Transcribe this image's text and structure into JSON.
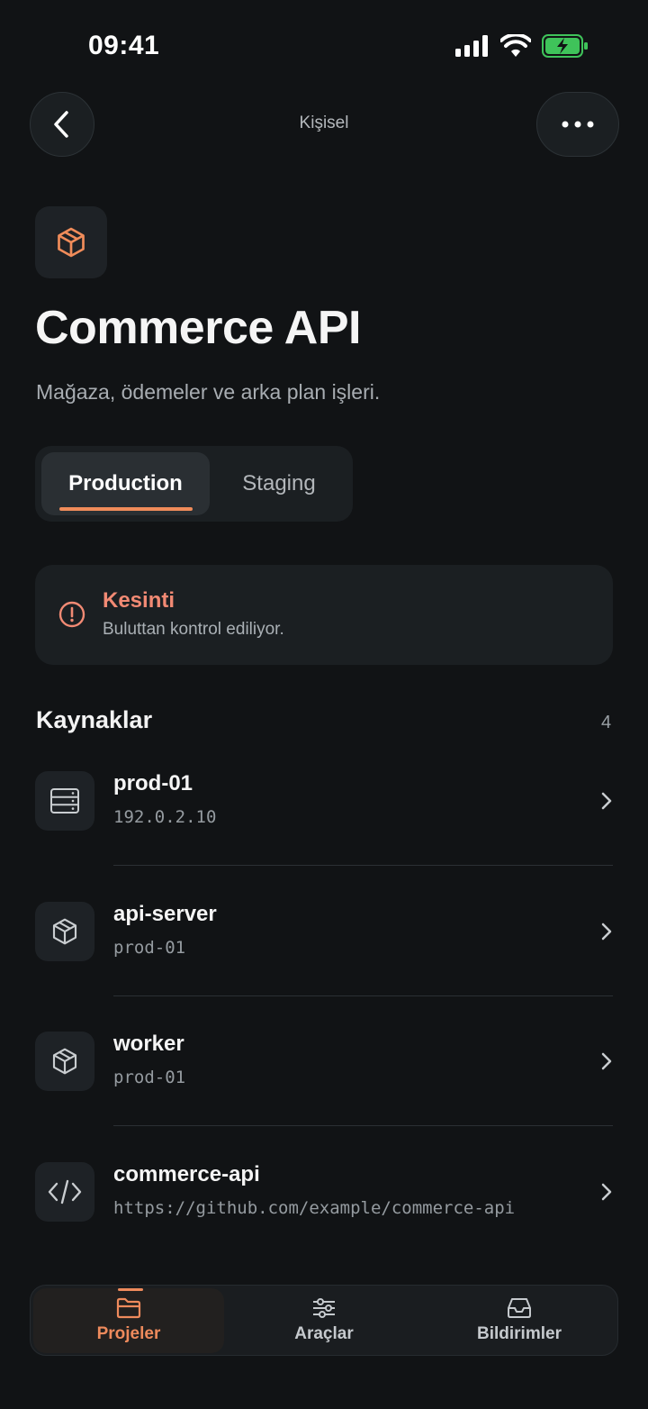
{
  "status_bar": {
    "time": "09:41"
  },
  "nav": {
    "title": "Kişisel"
  },
  "project": {
    "title": "Commerce API",
    "description": "Mağaza, ödemeler ve arka plan işleri."
  },
  "environments": {
    "production": "Production",
    "staging": "Staging",
    "selected": "Production"
  },
  "alert": {
    "title": "Kesinti",
    "subtitle": "Buluttan kontrol ediliyor."
  },
  "resources": {
    "title": "Kaynaklar",
    "count": "4",
    "items": [
      {
        "name": "prod-01",
        "detail": "192.0.2.10",
        "icon": "server-icon"
      },
      {
        "name": "api-server",
        "detail": "prod-01",
        "icon": "box-icon"
      },
      {
        "name": "worker",
        "detail": "prod-01",
        "icon": "box-icon"
      },
      {
        "name": "commerce-api",
        "detail": "https://github.com/example/commerce-api",
        "icon": "code-icon"
      }
    ]
  },
  "tabbar": {
    "projects": "Projeler",
    "tools": "Araçlar",
    "notifications": "Bildirimler",
    "active": "Projeler"
  },
  "colors": {
    "accent": "#f08c5a",
    "alert": "#f28a74",
    "background": "#111315"
  }
}
